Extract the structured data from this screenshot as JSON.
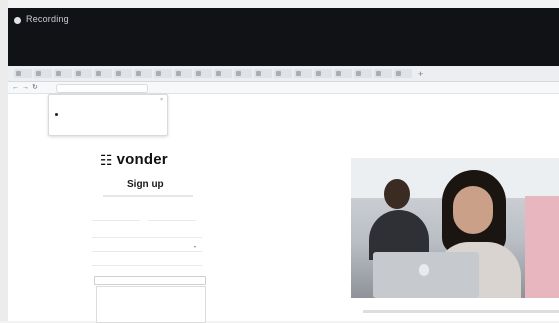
{
  "recorder": {
    "label": "Recording"
  },
  "signup": {
    "brand": "vonder",
    "heading": "Sign up"
  },
  "hero": {
    "caption": "",
    "logo_icon": "apple-logo-icon"
  },
  "icons": [
    "record-dot-icon",
    "back-icon",
    "forward-icon",
    "reload-icon",
    "brand-logo-icon",
    "close-icon",
    "chevron-down-icon"
  ]
}
